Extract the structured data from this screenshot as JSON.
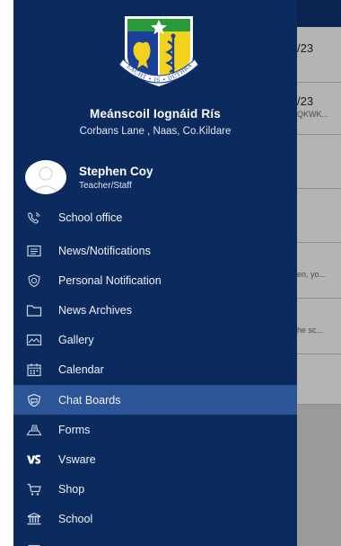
{
  "school": {
    "name": "Meánscoil Iognáid Rís",
    "address": "Corbans Lane , Naas, Co.Kildare",
    "motto": "DÍLSEACHT • IS • DÚTHRACHT"
  },
  "user": {
    "name": "Stephen Coy",
    "role": "Teacher/Staff"
  },
  "menu": [
    {
      "label": "School office",
      "icon": "phone-icon",
      "active": false
    },
    {
      "label": "News/Notifications",
      "icon": "newspaper-icon",
      "active": false
    },
    {
      "label": "Personal Notification",
      "icon": "badge-check-icon",
      "active": false
    },
    {
      "label": "News Archives",
      "icon": "folder-icon",
      "active": false
    },
    {
      "label": "Gallery",
      "icon": "image-icon",
      "active": false
    },
    {
      "label": "Calendar",
      "icon": "calendar-icon",
      "active": false
    },
    {
      "label": "Chat Boards",
      "icon": "chat-shield-icon",
      "active": true
    },
    {
      "label": "Forms",
      "icon": "forms-icon",
      "active": false
    },
    {
      "label": "Vsware",
      "icon": "vsware-icon",
      "active": false
    },
    {
      "label": "Shop",
      "icon": "cart-icon",
      "active": false
    },
    {
      "label": "School",
      "icon": "building-icon",
      "active": false
    }
  ],
  "background": {
    "items": [
      {
        "title": "/23",
        "subtitle": ""
      },
      {
        "title": "/23",
        "subtitle": "QKWK..."
      },
      {
        "title": "",
        "subtitle": "en, yo..."
      },
      {
        "title": "",
        "subtitle": "he sc..."
      }
    ]
  },
  "colors": {
    "drawer": "#0b2b5e",
    "active": "#2b5596",
    "header": "#0b2350"
  }
}
